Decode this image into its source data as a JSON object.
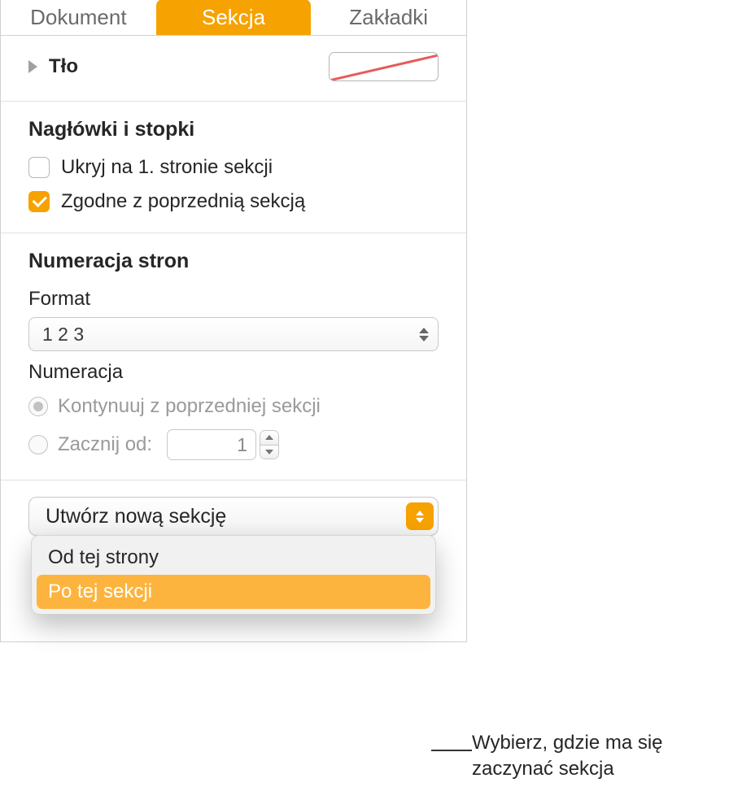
{
  "tabs": {
    "document": "Dokument",
    "section": "Sekcja",
    "bookmarks": "Zakładki"
  },
  "background": {
    "label": "Tło"
  },
  "headers_footers": {
    "heading": "Nagłówki i stopki",
    "hide_first": "Ukryj na 1. stronie sekcji",
    "match_previous": "Zgodne z poprzednią sekcją"
  },
  "page_numbers": {
    "heading": "Numeracja stron",
    "format_label": "Format",
    "format_value": "1  2  3",
    "numbering_label": "Numeracja",
    "continue_prev": "Kontynuuj z poprzedniej sekcji",
    "start_at_label": "Zacznij od:",
    "start_at_value": "1"
  },
  "create_section": {
    "button_label": "Utwórz nową sekcję",
    "option_from_page": "Od tej strony",
    "option_after_section": "Po tej sekcji"
  },
  "callout": {
    "text": "Wybierz, gdzie ma się zaczynać sekcja"
  }
}
